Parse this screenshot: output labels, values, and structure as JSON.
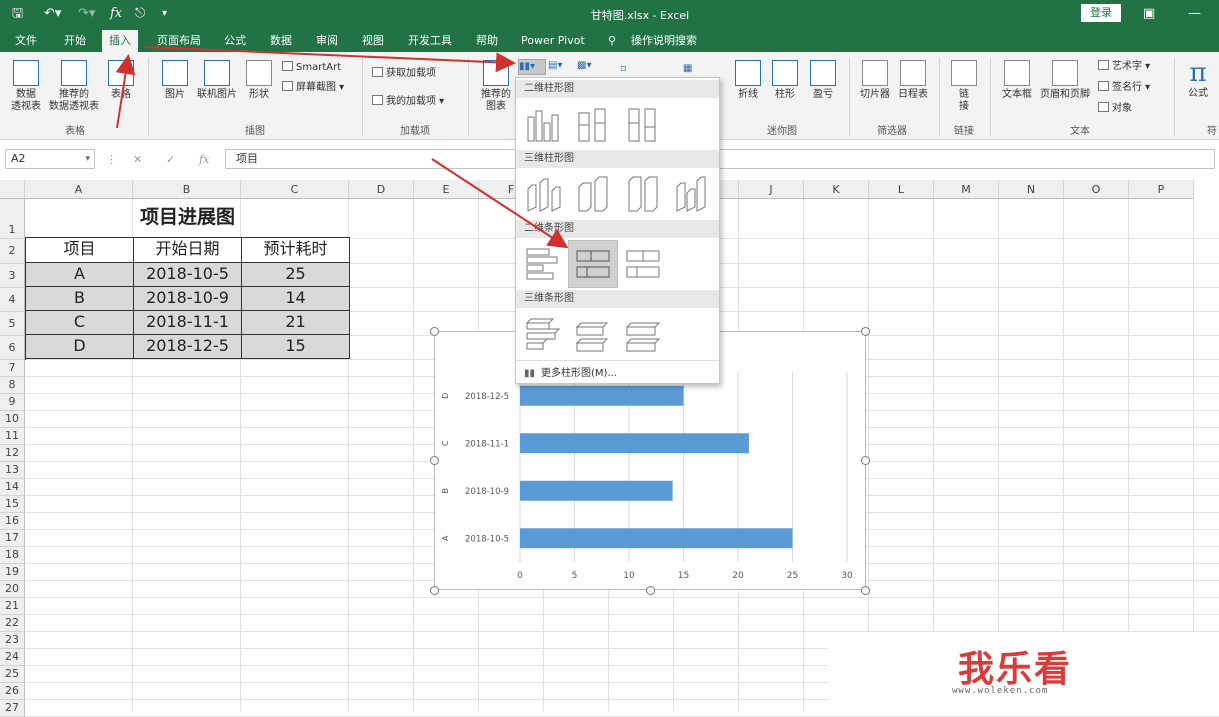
{
  "titlebar": {
    "document_title": "甘特图.xlsx  -  Excel",
    "login_label": "登录",
    "fx_glyph": "fx"
  },
  "tabs": [
    "文件",
    "开始",
    "插入",
    "页面布局",
    "公式",
    "数据",
    "审阅",
    "视图",
    "开发工具",
    "帮助",
    "Power Pivot",
    "操作说明搜索"
  ],
  "ribbon": {
    "pivot_table": "数据\n透视表",
    "recommended_pivot": "推荐的\n数据透视表",
    "table": "表格",
    "group_tables": "表格",
    "picture": "图片",
    "online_picture": "联机图片",
    "shapes": "形状",
    "smartart": "SmartArt",
    "screenshot": "屏幕截图 ▾",
    "group_illustrations": "插图",
    "get_addins": "获取加载项",
    "my_addins": "我的加载项 ▾",
    "group_addins": "加载项",
    "recommended_charts": "推荐的\n图表",
    "sparkline_line": "折线",
    "sparkline_column": "柱形",
    "sparkline_winloss": "盈亏",
    "group_sparklines": "迷你图",
    "slicer": "切片器",
    "timeline": "日程表",
    "group_filters": "筛选器",
    "link": "链\n接",
    "group_links": "链接",
    "textbox": "文本框",
    "header_footer": "页眉和页脚",
    "wordart": "艺术字 ▾",
    "signature": "签名行 ▾",
    "object": "对象",
    "group_text": "文本",
    "equation": "公式",
    "group_symbols": "符"
  },
  "formula_bar": {
    "name_box": "A2",
    "content": "项目"
  },
  "columns": [
    "A",
    "B",
    "C",
    "D",
    "E",
    "F",
    "G",
    "H",
    "I",
    "J",
    "K",
    "L",
    "M",
    "N",
    "O",
    "P"
  ],
  "rows": [
    "1",
    "2",
    "3",
    "4",
    "5",
    "6",
    "7",
    "8",
    "9",
    "10",
    "11",
    "12",
    "13",
    "14",
    "15",
    "16",
    "17",
    "18",
    "19",
    "20",
    "21",
    "22",
    "23",
    "24",
    "25",
    "26",
    "27"
  ],
  "sheet": {
    "title": "项目进展图",
    "headers": [
      "项目",
      "开始日期",
      "预计耗时"
    ],
    "data": [
      [
        "A",
        "2018-10-5",
        "25"
      ],
      [
        "B",
        "2018-10-9",
        "14"
      ],
      [
        "C",
        "2018-11-1",
        "21"
      ],
      [
        "D",
        "2018-12-5",
        "15"
      ]
    ]
  },
  "chart_data": {
    "type": "bar",
    "orientation": "horizontal",
    "categories": [
      {
        "outer": "A",
        "inner": "2018-10-5"
      },
      {
        "outer": "B",
        "inner": "2018-10-9"
      },
      {
        "outer": "C",
        "inner": "2018-11-1"
      },
      {
        "outer": "D",
        "inner": "2018-12-5"
      }
    ],
    "values": [
      25,
      14,
      21,
      15
    ],
    "xlim": [
      0,
      30
    ],
    "xticks": [
      "0",
      "5",
      "10",
      "15",
      "20",
      "25",
      "30"
    ],
    "grid": true,
    "bar_color": "#5b9bd5"
  },
  "dropdown": {
    "sections": [
      "二维柱形图",
      "三维柱形图",
      "二维条形图",
      "三维条形图"
    ],
    "more_label": "更多柱形图(M)..."
  },
  "watermark": {
    "text": "我乐看",
    "url": "www.woleken.com"
  },
  "colors": {
    "accent": "#217346",
    "arrow": "#d0312d"
  }
}
